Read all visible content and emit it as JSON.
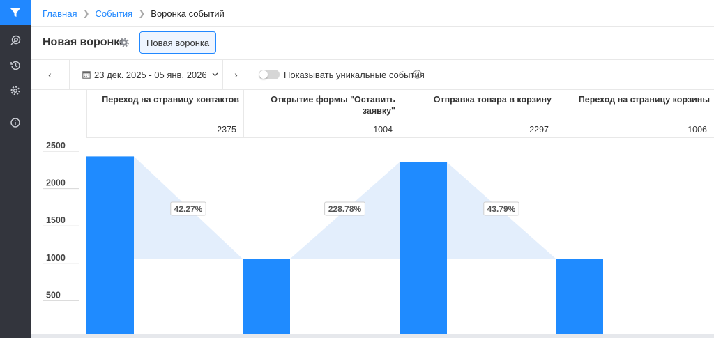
{
  "breadcrumb": {
    "home": "Главная",
    "events": "События",
    "current": "Воронка событий"
  },
  "page": {
    "title": "Новая воронка",
    "tab_label": "Новая воронка"
  },
  "toolbar": {
    "date_range": "23 дек. 2025 - 05 янв. 2026",
    "toggle_label": "Показывать уникальные события",
    "unique_enabled": false
  },
  "sidebar": {
    "icons": [
      "funnel-icon",
      "target-icon",
      "history-icon",
      "settings-icon",
      "info-icon"
    ],
    "active": "funnel-icon"
  },
  "colors": {
    "accent": "#2188ff",
    "bar": "#1f8bff",
    "conversion_fill": "#e3eefc",
    "sidebar": "#33353d"
  },
  "steps": [
    {
      "label": "Переход на страницу контактов",
      "value": "2375"
    },
    {
      "label": "Открытие формы \"Оставить заявку\"",
      "value": "1004"
    },
    {
      "label": "Отправка товара в корзину",
      "value": "2297"
    },
    {
      "label": "Переход на страницу корзины",
      "value": "1006"
    }
  ],
  "chart_data": {
    "type": "bar",
    "categories": [
      "Переход на страницу контактов",
      "Открытие формы \"Оставить заявку\"",
      "Отправка товара в корзину",
      "Переход на страницу корзины"
    ],
    "values": [
      2375,
      1004,
      2297,
      1006
    ],
    "conversions": [
      "42.27%",
      "228.78%",
      "43.79%"
    ],
    "yticks": [
      2500,
      2000,
      1500,
      1000,
      500
    ],
    "ylim": [
      0,
      2500
    ],
    "grid": false
  }
}
